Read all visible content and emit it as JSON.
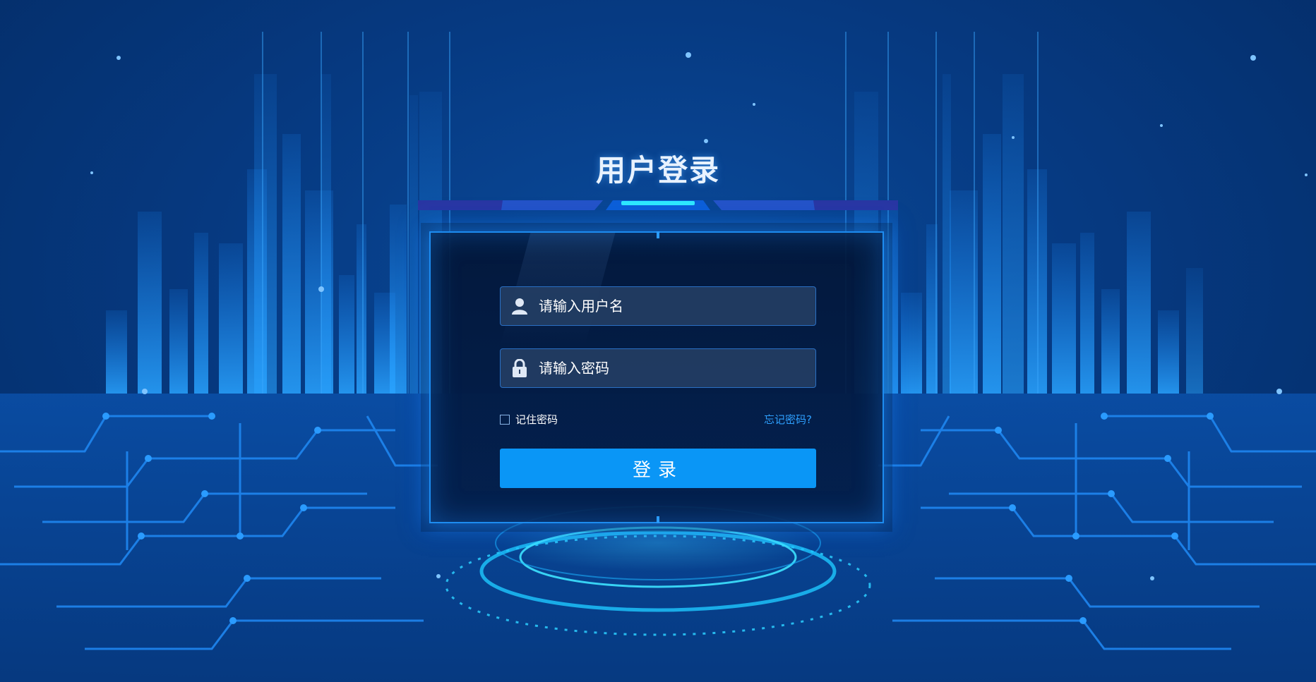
{
  "page": {
    "title": "用户登录"
  },
  "login": {
    "username_placeholder": "请输入用户名",
    "password_placeholder": "请输入密码",
    "remember_label": "记住密码",
    "forgot_label": "忘记密码?",
    "submit_label": "登录"
  },
  "icons": {
    "username": "user-icon",
    "password": "lock-icon",
    "remember": "checkbox"
  },
  "colors": {
    "background": "#063a82",
    "accent": "#0a96f6",
    "panel_border": "#1d8cf0",
    "link": "#2ea0ff",
    "title": "#e8f2ff"
  }
}
